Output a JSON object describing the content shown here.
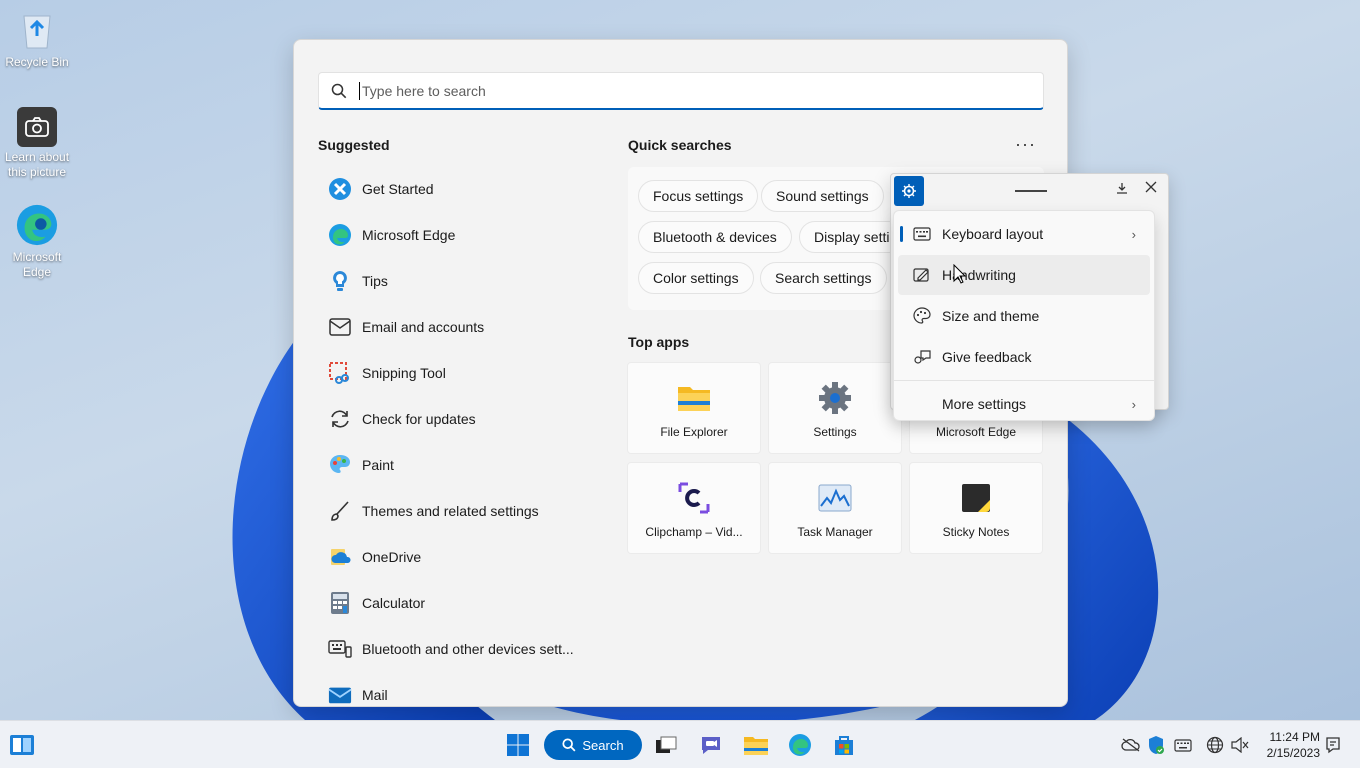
{
  "desktop": {
    "icons": [
      {
        "label": "Recycle Bin"
      },
      {
        "label": "Learn about this picture"
      },
      {
        "label": "Microsoft Edge"
      }
    ]
  },
  "search": {
    "placeholder": "Type here to search",
    "value": ""
  },
  "suggested": {
    "title": "Suggested",
    "items": [
      {
        "label": "Get Started",
        "icon": "get-started-icon"
      },
      {
        "label": "Microsoft Edge",
        "icon": "edge-icon"
      },
      {
        "label": "Tips",
        "icon": "tips-icon"
      },
      {
        "label": "Email and accounts",
        "icon": "mail-outline-icon"
      },
      {
        "label": "Snipping Tool",
        "icon": "snipping-tool-icon"
      },
      {
        "label": "Check for updates",
        "icon": "refresh-icon"
      },
      {
        "label": "Paint",
        "icon": "paint-icon"
      },
      {
        "label": "Themes and related settings",
        "icon": "brush-icon"
      },
      {
        "label": "OneDrive",
        "icon": "onedrive-icon"
      },
      {
        "label": "Calculator",
        "icon": "calculator-icon"
      },
      {
        "label": "Bluetooth and other devices sett...",
        "icon": "keyboard-devices-icon"
      },
      {
        "label": "Mail",
        "icon": "mail-icon"
      }
    ]
  },
  "quick_searches": {
    "title": "Quick searches",
    "chips": [
      {
        "label": "Focus settings"
      },
      {
        "label": "Sound settings"
      },
      {
        "label": "Bluetooth & devices"
      },
      {
        "label": "Display setti"
      },
      {
        "label": "Color settings"
      },
      {
        "label": "Search settings"
      }
    ]
  },
  "top_apps": {
    "title": "Top apps",
    "apps": [
      {
        "label": "File Explorer",
        "icon": "folder-icon"
      },
      {
        "label": "Settings",
        "icon": "settings-gear-icon"
      },
      {
        "label": "Microsoft Edge",
        "icon": "edge-icon"
      },
      {
        "label": "Clipchamp – Vid...",
        "icon": "clipchamp-icon"
      },
      {
        "label": "Task Manager",
        "icon": "task-manager-icon"
      },
      {
        "label": "Sticky Notes",
        "icon": "sticky-notes-icon"
      }
    ]
  },
  "keyboard_menu": {
    "items": [
      {
        "label": "Keyboard layout",
        "icon": "keyboard-icon",
        "submenu": true
      },
      {
        "label": "Handwriting",
        "icon": "pen-icon",
        "submenu": false
      },
      {
        "label": "Size and theme",
        "icon": "palette-icon",
        "submenu": false
      },
      {
        "label": "Give feedback",
        "icon": "feedback-icon",
        "submenu": false
      },
      {
        "label": "More settings",
        "icon": "",
        "submenu": true
      }
    ]
  },
  "taskbar": {
    "search_label": "Search",
    "time": "11:24 PM",
    "date": "2/15/2023"
  },
  "colors": {
    "accent": "#005fb8",
    "taskbar_search": "#0067c0"
  }
}
